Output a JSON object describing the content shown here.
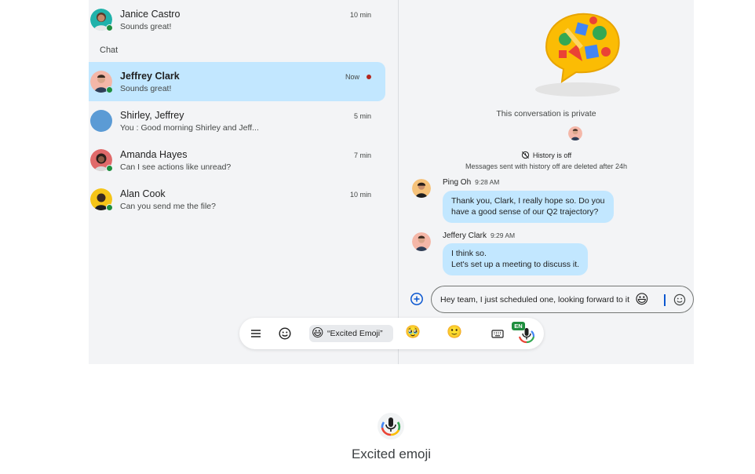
{
  "conversations_top": [
    {
      "name": "Janice Castro",
      "preview": "Sounds great!",
      "time": "10 min"
    }
  ],
  "section_label": "Chat",
  "conversations": [
    {
      "name": "Jeffrey Clark",
      "preview": "Sounds great!",
      "time": "Now",
      "selected": true
    },
    {
      "name": "Shirley, Jeffrey",
      "preview": "You : Good morning Shirley and Jeff...",
      "time": "5 min"
    },
    {
      "name": "Amanda Hayes",
      "preview": "Can I see actions like unread?",
      "time": "7 min"
    },
    {
      "name": "Alan Cook",
      "preview": "Can you send me the file?",
      "time": "10 min"
    }
  ],
  "conversation_info": {
    "private_text": "This conversation is private",
    "history_label": "History is off",
    "history_note": "Messages sent with history off are deleted after 24h"
  },
  "messages": [
    {
      "sender": "Ping Oh",
      "time": "9:28 AM",
      "lines": [
        "Thank you, Clark, I really hope so. Do you",
        "have a good sense of our Q2 trajectory?"
      ]
    },
    {
      "sender": "Jeffery Clark",
      "time": "9:29 AM",
      "lines": [
        "I think so.",
        "Let's set up a meeting to discuss it."
      ]
    }
  ],
  "compose": {
    "text": "Hey team, I just scheduled one, looking forward to it",
    "emoji": "😃"
  },
  "ime_toolbar": {
    "suggestion_emoji": "😃",
    "suggestion_label": "“Excited Emoji”",
    "emoji_2": "🥹",
    "emoji_3": "🙂",
    "language_badge": "EN"
  },
  "caption": "Excited emoji",
  "colors": {
    "selected_bg": "#c2e7ff",
    "bubble_bg": "#c2e7ff",
    "presence_green": "#1e8e3e",
    "unread_red": "#b3261e",
    "panel_bg": "#f3f4f6"
  },
  "icons": [
    "menu-icon",
    "smiley-icon",
    "keyboard-icon",
    "mic-icon",
    "add-circle-icon",
    "history-off-icon"
  ]
}
